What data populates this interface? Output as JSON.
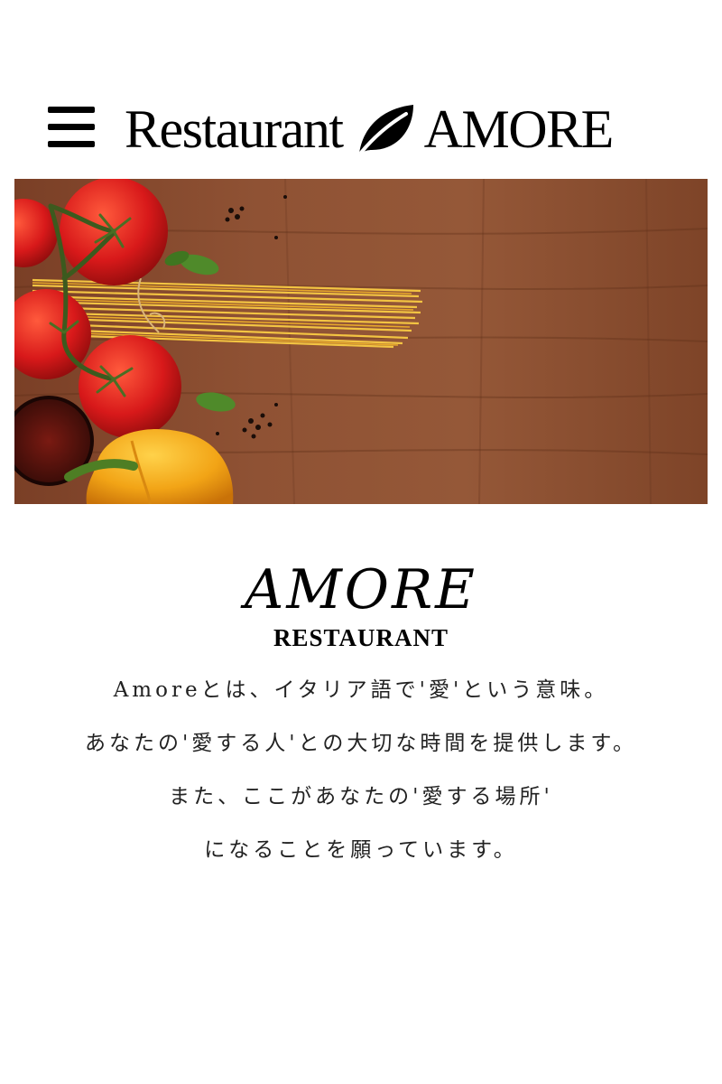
{
  "header": {
    "menu_icon": "hamburger-menu-icon",
    "brand_left": "Restaurant",
    "brand_icon": "leaf-icon",
    "brand_right": "AMORE"
  },
  "hero": {
    "image_subject": "tomatoes, spaghetti, bell peppers on wooden table"
  },
  "logo": {
    "main": "AMORE",
    "sub": "RESTAURANT"
  },
  "intro": {
    "lines": [
      "Amoreとは、イタリア語で'愛'という意味。",
      "あなたの'愛する人'との大切な時間を提供します。",
      "また、ここがあなたの'愛する場所'",
      "になることを願っています。"
    ]
  },
  "colors": {
    "text": "#000000",
    "wood": "#8a4a2e",
    "tomato": "#d8191a",
    "pepper": "#f2a416",
    "pasta": "#f0c040"
  }
}
